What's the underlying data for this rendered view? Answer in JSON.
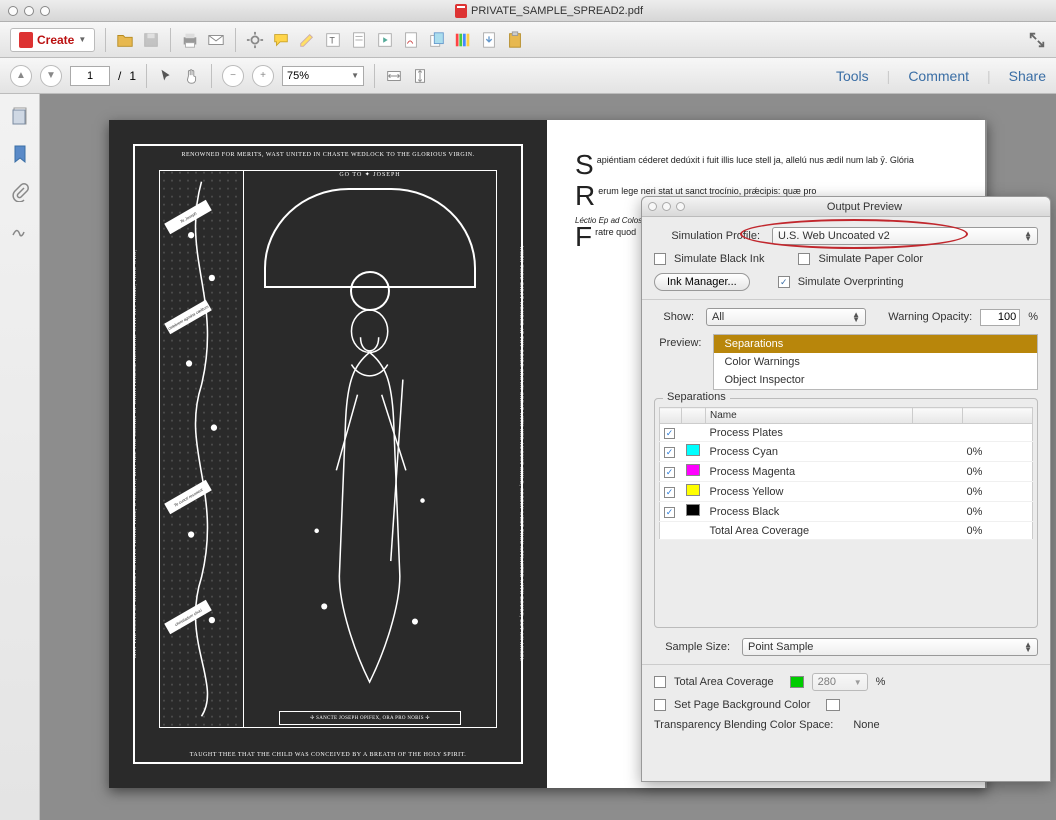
{
  "window": {
    "title": "PRIVATE_SAMPLE_SPREAD2.pdf"
  },
  "toolbar": {
    "create": "Create",
    "links": {
      "tools": "Tools",
      "comment": "Comment",
      "share": "Share"
    }
  },
  "nav": {
    "page_current": "1",
    "page_sep": "/",
    "page_total": "1",
    "zoom": "75%"
  },
  "doc": {
    "top_border": "RENOWNED FOR MERITS, WAST UNITED IN CHASTE WEDLOCK TO THE GLORIOUS VIRGIN.",
    "bottom_border": "TAUGHT THEE THAT THE CHILD WAS CONCEIVED BY A BREATH OF THE HOLY SPIRIT.",
    "left_border": "MAY THE HOSTS OF HEAVENLY SPIRITS PRAISE THEE, O JOSEPH; MAY ALL THE CHOIRS OF CHRISTENDOM RESOUND WITH THY NAME, THOU WHO,",
    "right_border": "WHEN THOU DIDST WONDER AT THY BRIDE GROWN GREAT WITH HER AUGUST CHILD, SORELY WERT THOU AFFLICTED WITH DOUBT; BUT AN ANGEL",
    "arch_text": "GO TO ✦ JOSEPH",
    "banner": "✢ SANCTE JOSEPH OPIFEX, ORA PRO NOBIS ✢",
    "ribbon1": "Te Joseph",
    "ribbon2": "celebrent agmina cælitum",
    "ribbon3": "Te cuncti resonent",
    "ribbon4": "christiadum chori",
    "para1": "apiéntiam céderet dedúxit i fuit illis luce stell ja, allelú nus ædil num lab ȳ. Glória",
    "para2": "erum lege neri stat ut sanct trocínio, prǽcipis: quæ pro",
    "para3_ital": "Léctio Ep ad Coloss",
    "para3": "ratre quod"
  },
  "panel": {
    "title": "Output Preview",
    "sim_profile_label": "Simulation Profile:",
    "sim_profile_value": "U.S. Web Uncoated v2",
    "simulate_black": "Simulate Black Ink",
    "simulate_paper": "Simulate Paper Color",
    "ink_manager": "Ink Manager...",
    "simulate_overprint": "Simulate Overprinting",
    "show_label": "Show:",
    "show_value": "All",
    "warning_opacity_label": "Warning Opacity:",
    "warning_opacity_value": "100",
    "pct": "%",
    "preview_label": "Preview:",
    "preview_options": [
      "Separations",
      "Color Warnings",
      "Object Inspector"
    ],
    "separations_group": "Separations",
    "name_col": "Name",
    "plates": [
      {
        "label": "Process Plates",
        "color": "",
        "value": ""
      },
      {
        "label": "Process Cyan",
        "color": "#00ffff",
        "value": "0%"
      },
      {
        "label": "Process Magenta",
        "color": "#ff00ff",
        "value": "0%"
      },
      {
        "label": "Process Yellow",
        "color": "#ffff00",
        "value": "0%"
      },
      {
        "label": "Process Black",
        "color": "#000000",
        "value": "0%"
      },
      {
        "label": "Total Area Coverage",
        "color": "",
        "value": "0%"
      }
    ],
    "sample_size_label": "Sample Size:",
    "sample_size_value": "Point Sample",
    "total_area_coverage": "Total Area Coverage",
    "tac_value": "280",
    "set_bg": "Set Page Background Color",
    "transparency_label": "Transparency Blending Color Space:",
    "transparency_value": "None"
  }
}
